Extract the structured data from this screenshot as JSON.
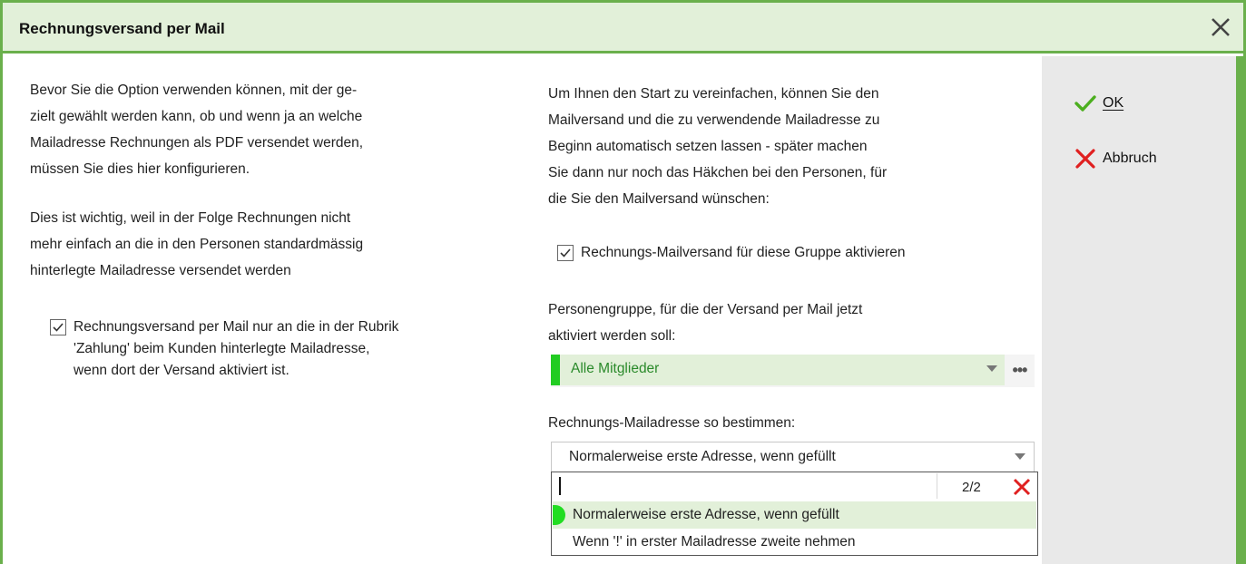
{
  "dialog": {
    "title": "Rechnungsversand per Mail",
    "close_icon": "close-icon"
  },
  "left": {
    "paragraph1": [
      "Bevor Sie die Option verwenden können, mit der ge-",
      "zielt gewählt werden kann, ob und wenn ja an welche",
      "Mailadresse Rechnungen als PDF versendet werden,",
      "müssen Sie dies hier konfigurieren."
    ],
    "paragraph2": [
      "Dies ist wichtig, weil in der Folge Rechnungen nicht",
      "mehr einfach an die in den Personen standardmässig",
      "hinterlegte Mailadresse versendet werden"
    ],
    "checkbox": {
      "checked": true,
      "lines": [
        "Rechnungsversand per Mail nur an die in der Rubrik",
        "'Zahlung' beim Kunden hinterlegte Mailadresse,",
        "wenn dort der Versand aktiviert ist."
      ]
    }
  },
  "right": {
    "intro": [
      "Um Ihnen den Start zu vereinfachen, können Sie den",
      "Mailversand und die zu verwendende Mailadresse zu",
      "Beginn automatisch setzen lassen - später machen",
      "Sie dann nur noch das Häkchen bei den Personen, für",
      "die Sie den Mailversand wünschen:"
    ],
    "checkbox": {
      "checked": true,
      "label": "Rechnungs-Mailversand für diese Gruppe aktivieren"
    },
    "group_label": [
      "Personengruppe, für die der Versand per Mail jetzt",
      "aktiviert werden soll:"
    ],
    "group_value": "Alle Mitglieder",
    "group_more": "•••",
    "mail_label": "Rechnungs-Mailadresse so bestimmen:",
    "mail_value": "Normalerweise erste Adresse, wenn gefüllt",
    "dropdown": {
      "search_value": "",
      "count": "2/2",
      "options": [
        "Normalerweise erste Adresse, wenn gefüllt",
        "Wenn '!' in erster Mailadresse zweite nehmen"
      ],
      "selected_index": 0
    }
  },
  "actions": {
    "ok_label": "OK",
    "cancel_label": "Abbruch"
  },
  "colors": {
    "accent_green": "#6ab04c",
    "title_bg": "#e2f0d9",
    "marker_green": "#22cc22",
    "cancel_red": "#e02020"
  }
}
